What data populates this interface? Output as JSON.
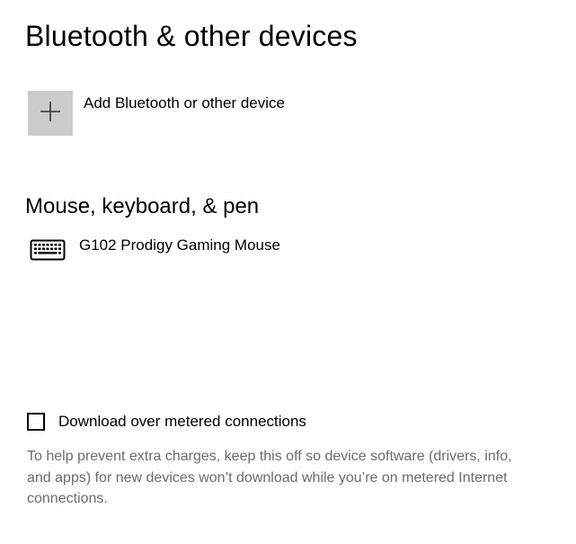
{
  "page": {
    "title": "Bluetooth & other devices"
  },
  "add_device": {
    "icon": "plus-icon",
    "label": "Add Bluetooth or other device"
  },
  "mouse_keyboard_section": {
    "heading": "Mouse, keyboard, & pen",
    "devices": [
      {
        "icon": "keyboard-icon",
        "name": "G102 Prodigy Gaming Mouse"
      }
    ]
  },
  "metered_download": {
    "checked": false,
    "label": "Download over metered connections",
    "description": "To help prevent extra charges, keep this off so device software (drivers, info, and apps) for new devices won’t download while you’re on metered Internet connections."
  },
  "colors": {
    "add_tile_background": "#cccccc",
    "help_text": "#6b6b6b",
    "text": "#000000",
    "background": "#ffffff"
  }
}
